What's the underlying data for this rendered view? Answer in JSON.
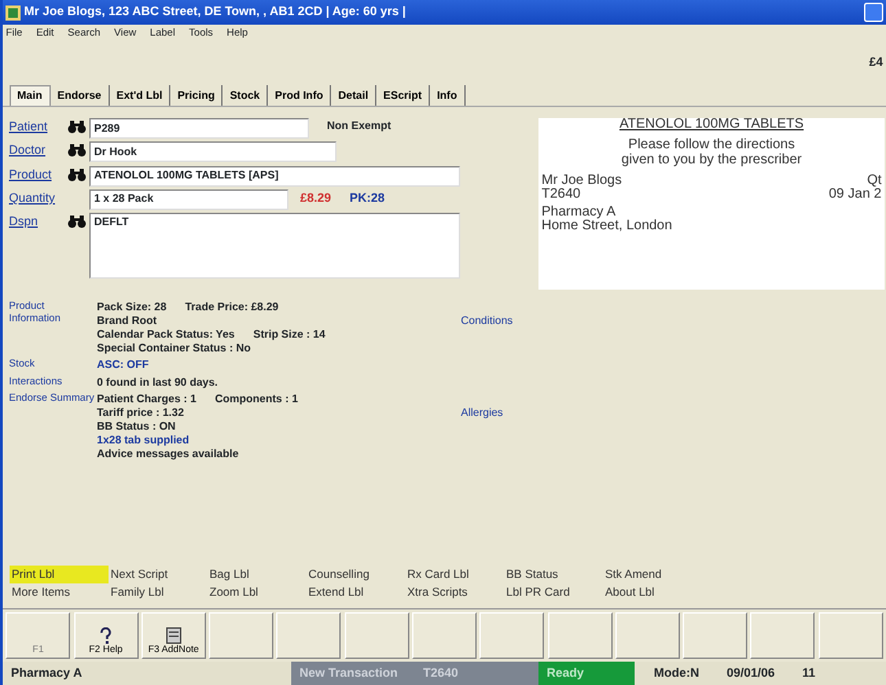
{
  "window": {
    "title": "Mr Joe Blogs, 123 ABC Street, DE Town, , AB1 2CD | Age: 60 yrs |"
  },
  "menu": [
    "File",
    "Edit",
    "Search",
    "View",
    "Label",
    "Tools",
    "Help"
  ],
  "balance": "£4",
  "tabs": [
    {
      "label": "Main",
      "selected": true
    },
    {
      "label": "Endorse",
      "selected": false
    },
    {
      "label": "Ext'd Lbl",
      "selected": false
    },
    {
      "label": "Pricing",
      "selected": false
    },
    {
      "label": "Stock",
      "selected": false
    },
    {
      "label": "Prod Info",
      "selected": false
    },
    {
      "label": "Detail",
      "selected": false
    },
    {
      "label": "EScript",
      "selected": false
    },
    {
      "label": "Info",
      "selected": false
    }
  ],
  "form": {
    "patient": {
      "label": "Patient",
      "value": "P289",
      "note": "Non Exempt"
    },
    "doctor": {
      "label": "Doctor",
      "value": "Dr Hook"
    },
    "product": {
      "label": "Product",
      "value": "ATENOLOL 100MG TABLETS [APS]"
    },
    "quantity": {
      "label": "Quantity",
      "value": "1 x 28 Pack",
      "price": "£8.29",
      "pack": "PK:28"
    },
    "dispense": {
      "label": "Dspn",
      "value": "DEFLT"
    }
  },
  "label_preview": {
    "title": "ATENOLOL 100MG TABLETS",
    "instructions": "Please follow the directions given to you by the prescriber",
    "patient": "Mr Joe Blogs",
    "ref": "T2640",
    "qty": "Qt",
    "date": "09 Jan 2",
    "pharmacy": "Pharmacy A",
    "address": "Home Street, London"
  },
  "info_sections": [
    {
      "label": "Product Information",
      "link": "Conditions",
      "lines": [
        {
          "kind": "text",
          "parts": [
            "Pack Size: 28",
            "Trade Price: £8.29"
          ]
        },
        {
          "kind": "text",
          "parts": [
            "Brand Root"
          ]
        },
        {
          "kind": "text",
          "parts": [
            "Calendar Pack Status: Yes",
            "Strip Size : 14"
          ]
        },
        {
          "kind": "text",
          "parts": [
            "Special Container Status : No"
          ]
        }
      ]
    },
    {
      "label": "Stock",
      "lines": [
        {
          "kind": "link",
          "parts": [
            "ASC: OFF"
          ]
        }
      ]
    },
    {
      "label": "Interactions",
      "lines": [
        {
          "kind": "text",
          "parts": [
            "0 found in last 90 days."
          ]
        }
      ]
    },
    {
      "label": "Endorse Summary",
      "link": "Allergies",
      "lines": [
        {
          "kind": "text",
          "parts": [
            "Patient Charges : 1",
            "Components : 1"
          ]
        },
        {
          "kind": "text",
          "parts": [
            "Tariff price : 1.32"
          ]
        },
        {
          "kind": "text",
          "parts": [
            "BB Status : ON"
          ]
        },
        {
          "kind": "link",
          "parts": [
            "1x28 tab supplied"
          ]
        },
        {
          "kind": "text",
          "parts": [
            "Advice messages available"
          ]
        }
      ]
    }
  ],
  "actions": [
    [
      {
        "label": "Print Lbl",
        "selected": true
      },
      {
        "label": "Next Script",
        "selected": false
      },
      {
        "label": "Bag Lbl",
        "selected": false
      },
      {
        "label": "Counselling",
        "selected": false
      },
      {
        "label": "Rx Card Lbl",
        "selected": false
      },
      {
        "label": "BB Status",
        "selected": false
      },
      {
        "label": "Stk Amend",
        "selected": false
      }
    ],
    [
      {
        "label": "More Items",
        "selected": false
      },
      {
        "label": "Family Lbl",
        "selected": false
      },
      {
        "label": "Zoom Lbl",
        "selected": false
      },
      {
        "label": "Extend Lbl",
        "selected": false
      },
      {
        "label": "Xtra Scripts",
        "selected": false
      },
      {
        "label": "Lbl PR Card",
        "selected": false
      },
      {
        "label": "About Lbl",
        "selected": false
      }
    ]
  ],
  "function_keys": [
    {
      "kind": "blank",
      "label": "F1"
    },
    {
      "kind": "help",
      "label": "F2 Help"
    },
    {
      "kind": "note",
      "label": "F3 AddNote"
    },
    {
      "kind": "blank"
    },
    {
      "kind": "blank"
    },
    {
      "kind": "blank"
    },
    {
      "kind": "blank"
    },
    {
      "kind": "blank"
    },
    {
      "kind": "blank"
    },
    {
      "kind": "blank"
    },
    {
      "kind": "blank"
    },
    {
      "kind": "blank"
    },
    {
      "kind": "blank"
    }
  ],
  "status_bar": [
    {
      "kind": "plain",
      "text": "Pharmacy A"
    },
    {
      "kind": "grey",
      "text": "New Transaction"
    },
    {
      "kind": "grey",
      "text": "T2640"
    },
    {
      "kind": "green",
      "text": "Ready"
    },
    {
      "kind": "plain",
      "text": "Mode:N"
    },
    {
      "kind": "plain",
      "text": "09/01/06"
    },
    {
      "kind": "plain",
      "text": "11"
    }
  ]
}
